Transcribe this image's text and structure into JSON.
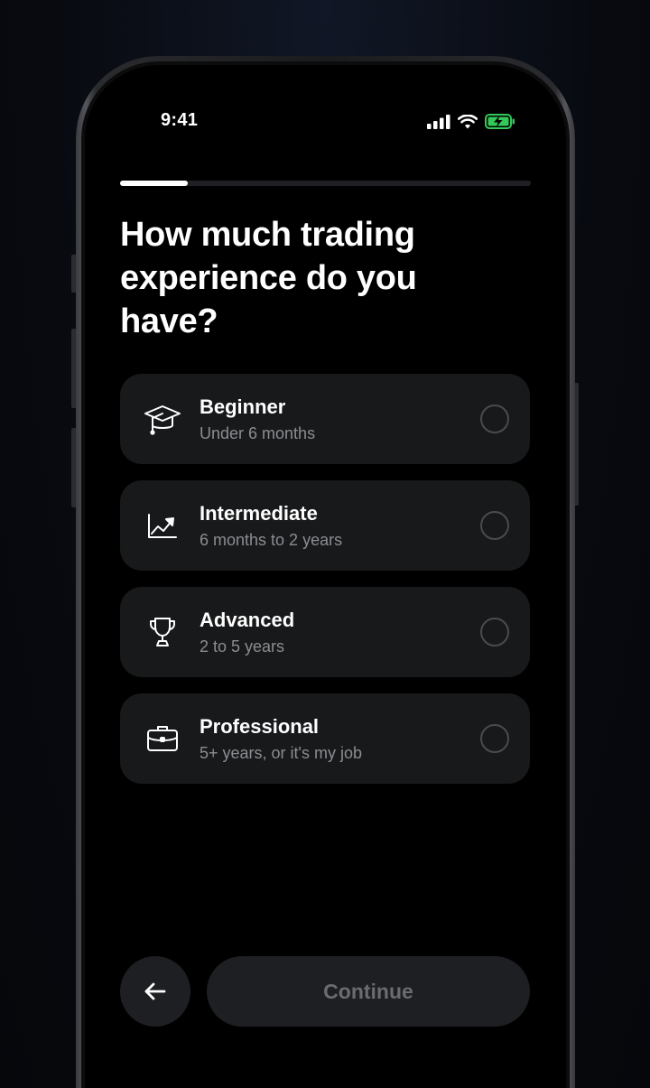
{
  "status": {
    "time": "9:41",
    "icons": [
      "cellular-signal-icon",
      "wifi-icon",
      "battery-charging-icon"
    ]
  },
  "onboarding": {
    "progress": 0.165,
    "title": "How much trading experience do you have?"
  },
  "options": [
    {
      "label": "Beginner",
      "sub": "Under 6 months",
      "icon": "graduation-cap-icon",
      "selected": false
    },
    {
      "label": "Intermediate",
      "sub": "6 months to 2 years",
      "icon": "trend-chart-icon",
      "selected": false
    },
    {
      "label": "Advanced",
      "sub": "2 to 5 years",
      "icon": "trophy-icon",
      "selected": false
    },
    {
      "label": "Professional",
      "sub": "5+ years, or it's my job",
      "icon": "briefcase-icon",
      "selected": false
    }
  ],
  "footer": {
    "back_icon": "arrow-left-icon",
    "continue_label": "Continue"
  },
  "colors": {
    "background": "#000000",
    "card": "#18191b",
    "accent": "#ffffff",
    "battery": "#34c759",
    "muted_text": "#8c8d92"
  }
}
